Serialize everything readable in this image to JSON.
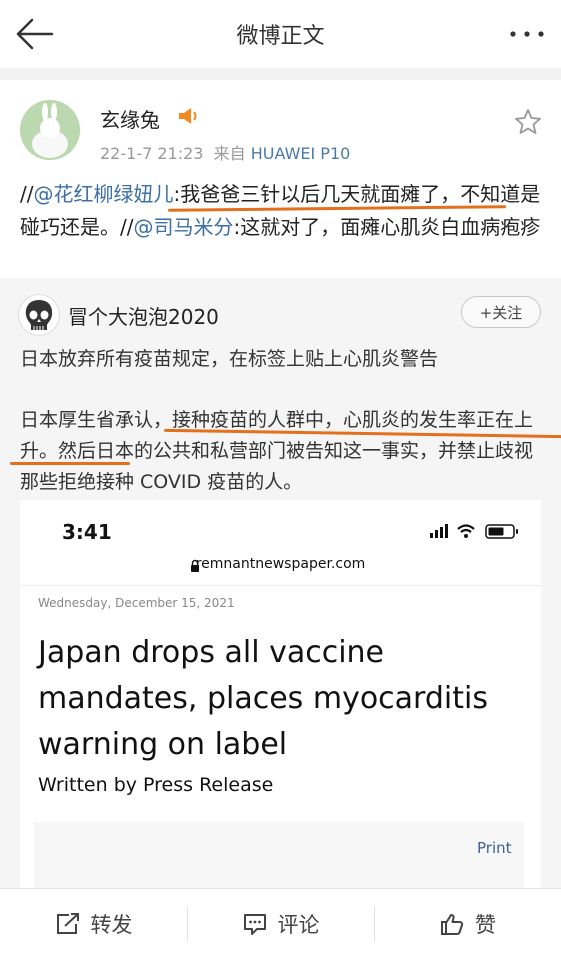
{
  "header": {
    "title": "微博正文",
    "back_icon": "arrow-left-icon",
    "more_icon": "ellipsis-icon"
  },
  "post": {
    "username": "玄缘兔",
    "badge_icon": "megaphone-icon",
    "time": "22-1-7 21:23",
    "source_prefix": "来自",
    "device": "HUAWEI P10",
    "repost_text": {
      "slashes1": "//",
      "mention1": "@花红柳绿妞儿",
      "text1": ":我爸爸三针以后几天就面瘫了，不知道是碰巧还是。",
      "slashes2": "//",
      "mention2": "@司马米分",
      "text2": ":这就对了，面瘫心肌炎白血病疱疹"
    }
  },
  "original": {
    "username": "冒个大泡泡2020",
    "follow_label": "+关注",
    "paragraph1": "日本放弃所有疫苗规定，在标签上贴上心肌炎警告",
    "paragraph2": "日本厚生省承认，接种疫苗的人群中，心肌炎的发生率正在上升。然后日本的公共和私营部门被告知这一事实，并禁止歧视那些拒绝接种 COVID 疫苗的人。"
  },
  "screenshot": {
    "time": "3:41",
    "url": "remnantnewspaper.com",
    "date": "Wednesday, December 15, 2021",
    "title": "Japan drops all vaccine mandates, places myocarditis warning on label",
    "byline": "Written by  Press Release",
    "print_label": "Print"
  },
  "actions": {
    "repost": "转发",
    "comment": "评论",
    "like": "赞"
  },
  "colors": {
    "mention": "#3b6fa6",
    "underline": "#e2701d",
    "device": "#4a7aa8"
  }
}
